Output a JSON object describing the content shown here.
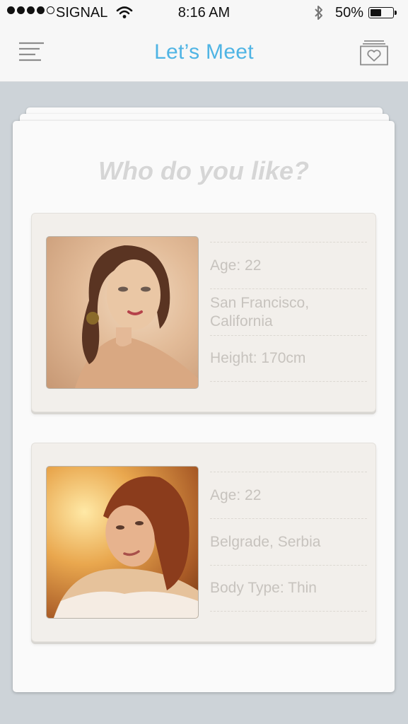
{
  "status_bar": {
    "carrier": "SIGNAL",
    "time": "8:16 AM",
    "battery_percent": "50%",
    "battery_level": 0.5,
    "signal_bars": 4
  },
  "nav": {
    "title": "Let’s Meet",
    "menu_icon": "hamburger-menu-icon",
    "favorites_icon": "heart-box-icon",
    "accent_color": "#4fb4e4"
  },
  "card": {
    "heading": "Who do you like?"
  },
  "profiles": [
    {
      "photo": "portrait-photo",
      "age": "Age: 22",
      "location": "San Francisco, California",
      "detail": "Height: 170cm"
    },
    {
      "photo": "portrait-photo",
      "age": "Age: 22",
      "location": "Belgrade, Serbia",
      "detail": "Body Type: Thin"
    }
  ]
}
